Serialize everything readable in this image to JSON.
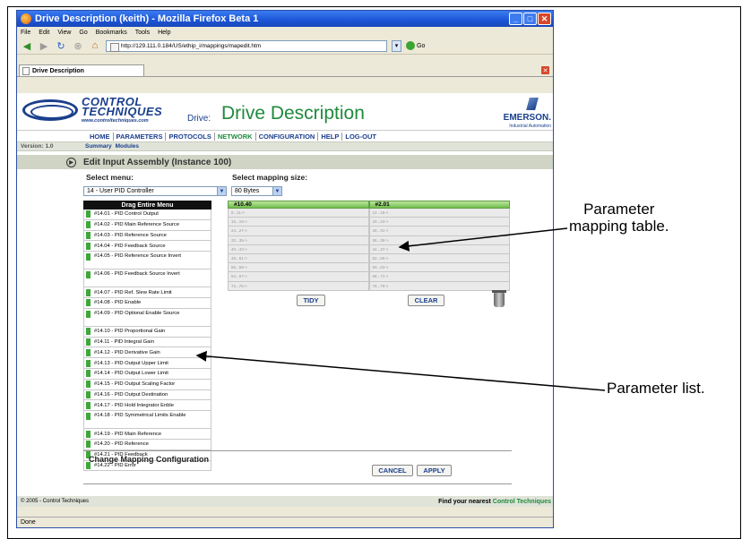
{
  "window": {
    "title": "Drive Description (keith) - Mozilla Firefox Beta 1"
  },
  "browser_menu": [
    "File",
    "Edit",
    "View",
    "Go",
    "Bookmarks",
    "Tools",
    "Help"
  ],
  "address": {
    "url": "http://129.111.0.184/US/ethip_i/mappings/mapedit.htm",
    "go_label": "Go"
  },
  "tab": {
    "label": "Drive Description"
  },
  "header": {
    "logo_line1": "CONTROL",
    "logo_line2": "TECHNIQUES",
    "logo_url": "www.controltechniques.com",
    "drive_label": "Drive:",
    "drive_title": "Drive Description",
    "brand": "EMERSON.",
    "brand_sub": "Industrial Automation"
  },
  "nav": [
    "HOME",
    "PARAMETERS",
    "PROTOCOLS",
    "NETWORK",
    "CONFIGURATION",
    "HELP",
    "LOG-OUT"
  ],
  "nav_active": "NETWORK",
  "submenu": {
    "version": "Version: 1.0",
    "items": [
      "Summary",
      "Modules"
    ]
  },
  "section_title": "Edit Input Assembly (Instance 100)",
  "select_menu": {
    "label": "Select menu:",
    "value": "14 - User PID Controller"
  },
  "mapping_size": {
    "label": "Select mapping size:",
    "value": "80 Bytes"
  },
  "param_list": {
    "header": "Drag Entire Menu",
    "items": [
      "#14.01 - PID Control Output",
      "#14.02 - PID Main Reference Source",
      "#14.03 - PID Reference Source",
      "#14.04 - PID Feedback Source",
      "#14.05 - PID Reference Source Invert",
      "#14.06 - PID Feedback Source Invert",
      "#14.07 - PID Ref. Slew Rate Limit",
      "#14.08 - PID Enable",
      "#14.09 - PID Optional Enable Source",
      "#14.10 - PID Proportional Gain",
      "#14.11 - PID Integral Gain",
      "#14.12 - PID Derivative Gain",
      "#14.13 - PID Output Upper Limit",
      "#14.14 - PID Output Lower Limit",
      "#14.15 - PID Output Scaling Factor",
      "#14.16 - PID Output Destination",
      "#14.17 - PID Hold Integrator Enble",
      "#14.18 - PID Symmetrical Limits Enable",
      "#14.19 - PID Main Reference",
      "#14.20 - PID Reference",
      "#14.21 - PID Feedback",
      "#14.22 - PID Error"
    ]
  },
  "mapping_table": {
    "headers": [
      "#10.40",
      "#2.01"
    ],
    "rows": [
      [
        "8...11->",
        "12...15->"
      ],
      [
        "16...19->",
        "20...23->"
      ],
      [
        "24...27->",
        "28...31->"
      ],
      [
        "32...35->",
        "36...39->"
      ],
      [
        "40...43->",
        "44...47->"
      ],
      [
        "48...51->",
        "52...55->"
      ],
      [
        "56...59->",
        "60...63->"
      ],
      [
        "64...67->",
        "68...71->"
      ],
      [
        "72...75->",
        "76...79->"
      ]
    ]
  },
  "buttons": {
    "tidy": "TIDY",
    "clear": "CLEAR",
    "cancel": "CANCEL",
    "apply": "APPLY"
  },
  "change_mapping_title": "Change Mapping Configuration",
  "footer": {
    "copyright": "© 2005 - Control Techniques",
    "find_prefix": "Find your nearest ",
    "find_link": "Control Techniques"
  },
  "status": "Done",
  "callouts": {
    "mapping": [
      "Parameter",
      "mapping table."
    ],
    "list": "Parameter list."
  }
}
